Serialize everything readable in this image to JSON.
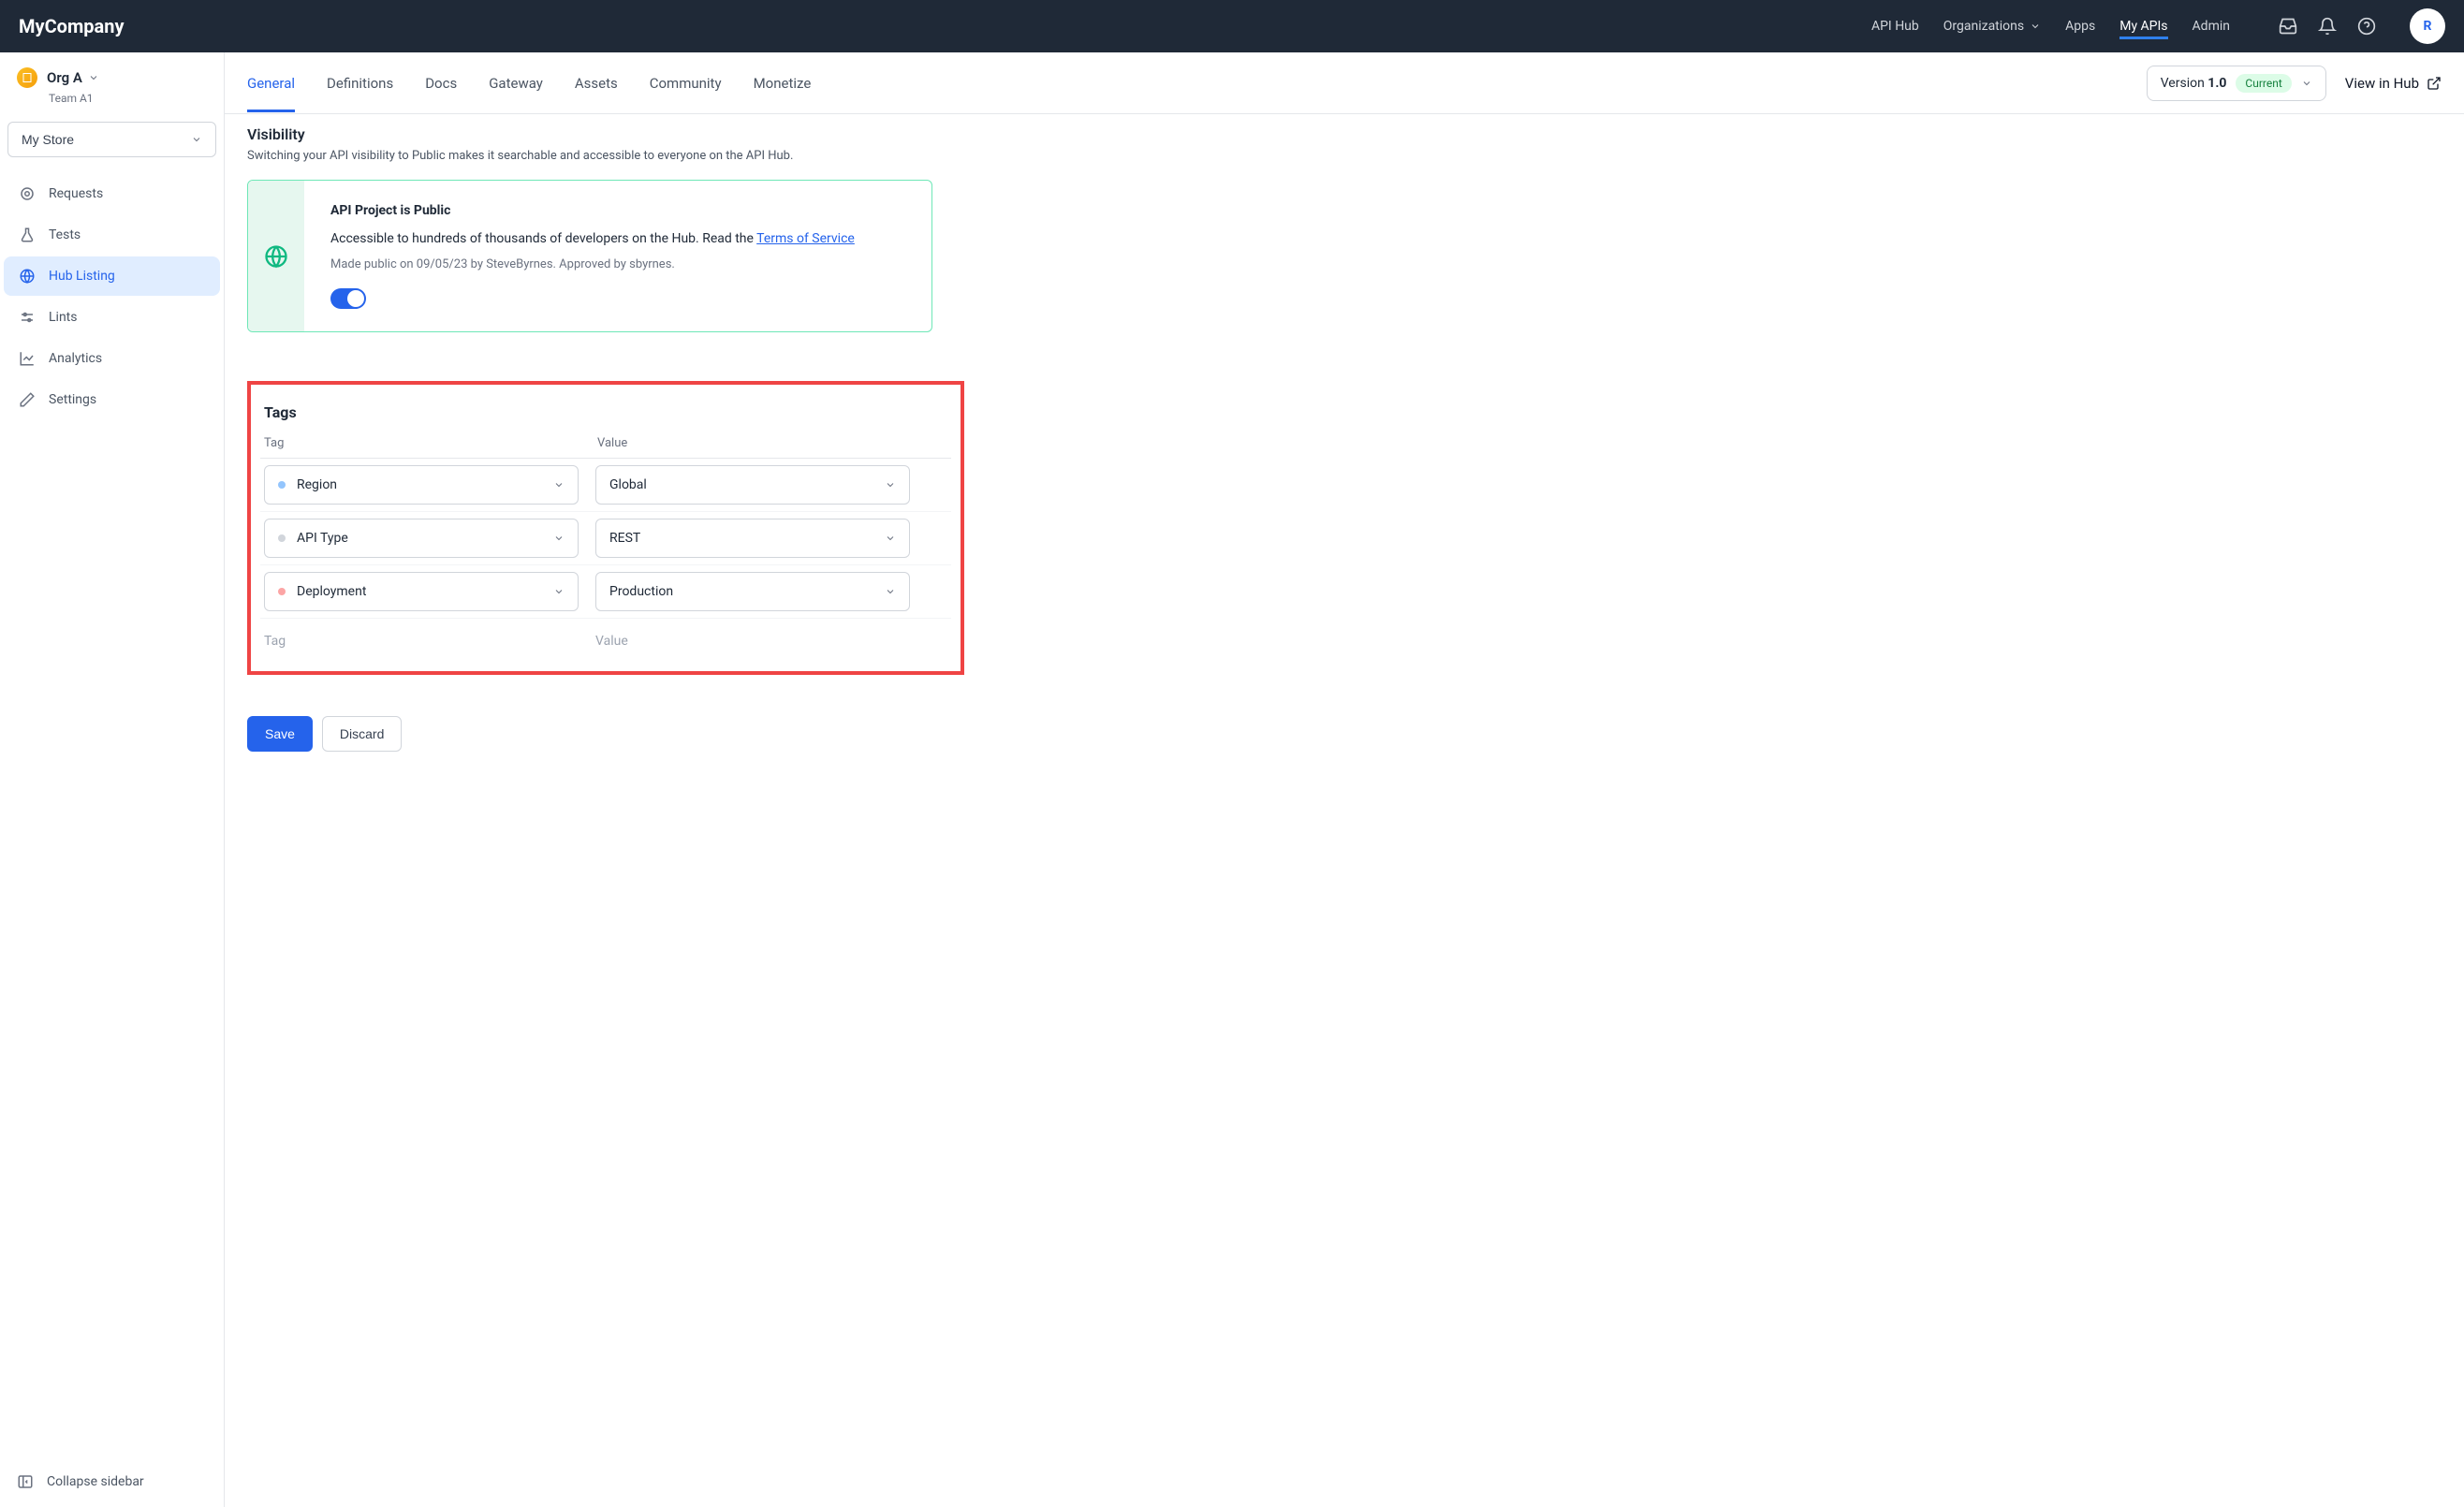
{
  "brand": "MyCompany",
  "topnav": {
    "api_hub": "API Hub",
    "organizations": "Organizations",
    "apps": "Apps",
    "my_apis": "My APIs",
    "admin": "Admin"
  },
  "avatar_initial": "R",
  "org": {
    "name": "Org A",
    "team": "Team A1"
  },
  "store_selector": "My Store",
  "sidenav": {
    "requests": "Requests",
    "tests": "Tests",
    "hub_listing": "Hub Listing",
    "lints": "Lints",
    "analytics": "Analytics",
    "settings": "Settings"
  },
  "collapse": "Collapse sidebar",
  "tabs": {
    "general": "General",
    "definitions": "Definitions",
    "docs": "Docs",
    "gateway": "Gateway",
    "assets": "Assets",
    "community": "Community",
    "monetize": "Monetize"
  },
  "version": {
    "prefix": "Version ",
    "number": "1.0",
    "chip": "Current"
  },
  "view_in_hub": "View in Hub",
  "visibility": {
    "title": "Visibility",
    "desc": "Switching your API visibility to Public makes it searchable and accessible to everyone on the API Hub.",
    "card_title": "API Project is Public",
    "card_text_1": "Accessible to hundreds of thousands of developers on the Hub. Read the ",
    "tos": "Terms of Service",
    "meta": "Made public on 09/05/23 by SteveByrnes. Approved by sbyrnes."
  },
  "tags": {
    "title": "Tags",
    "header_tag": "Tag",
    "header_value": "Value",
    "rows": [
      {
        "dot": "#93c5fd",
        "name": "Region",
        "value": "Global"
      },
      {
        "dot": "#d1d5db",
        "name": "API Type",
        "value": "REST"
      },
      {
        "dot": "#fca5a5",
        "name": "Deployment",
        "value": "Production"
      }
    ],
    "empty_tag": "Tag",
    "empty_value": "Value"
  },
  "buttons": {
    "save": "Save",
    "discard": "Discard"
  }
}
